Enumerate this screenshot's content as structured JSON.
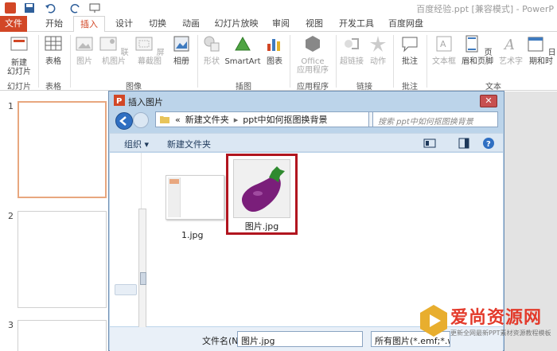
{
  "window": {
    "title": "百度经验.ppt [兼容模式] - PowerP"
  },
  "ribbon_tabs": [
    "文件",
    "开始",
    "插入",
    "设计",
    "切换",
    "动画",
    "幻灯片放映",
    "审阅",
    "视图",
    "开发工具",
    "百度网盘"
  ],
  "ribbon": {
    "new_slide": "新建\n幻灯片",
    "table": "表格",
    "picture": "图片",
    "online_picture": "联机图片",
    "screenshot": "屏幕截图",
    "album": "相册",
    "shapes": "形状",
    "smartart": "SmartArt",
    "chart": "图表",
    "office_apps": "Office\n应用程序",
    "hyperlink": "超链接",
    "action": "动作",
    "comment": "批注",
    "textbox": "文本框",
    "header_footer": "页眉和页脚",
    "wordart": "艺术字",
    "datetime": "日期和时",
    "groups": {
      "slides": "幻灯片",
      "tables": "表格",
      "images": "图像",
      "illustrations": "插图",
      "apps": "应用程序",
      "links": "链接",
      "comments": "批注",
      "text": "文本"
    }
  },
  "thumbnails": {
    "numbers": [
      "1",
      "2",
      "3"
    ]
  },
  "dialog": {
    "title": "插入图片",
    "breadcrumb": [
      "«",
      "新建文件夹",
      "▸",
      "ppt中如何抠图换背景"
    ],
    "search_placeholder": "搜索 ppt中如何抠图换背景",
    "organize": "组织 ▾",
    "new_folder": "新建文件夹",
    "files": [
      {
        "name": "1.jpg"
      },
      {
        "name": "图片.jpg"
      }
    ],
    "filename_label": "文件名(N):",
    "filename_value": "图片.jpg",
    "filetype_value": "所有图片(*.emf;*.w"
  },
  "watermark": {
    "title": "爱尚资源网",
    "subtitle": "更新全网最新PPT素材资源教程模板"
  },
  "colors": {
    "accent": "#d24726",
    "selection": "#b1151f",
    "dialog_chrome": "#bcd4ea"
  }
}
